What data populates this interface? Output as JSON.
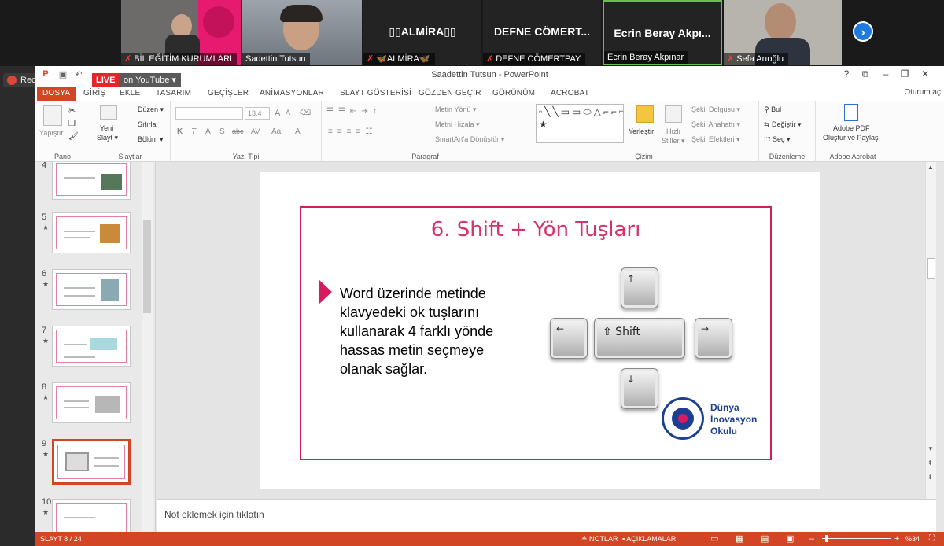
{
  "meeting": {
    "participants": [
      {
        "name": "BİL EĞİTİM KURUMLARI",
        "muted": true,
        "kind": "video"
      },
      {
        "name": "Sadettin Tutsun",
        "muted": false,
        "kind": "video"
      },
      {
        "name": "🦋ALMİRA🦋",
        "display": "▯▯ALMİRA▯▯",
        "muted": true,
        "kind": "name"
      },
      {
        "name": "DEFNE CÖMERTPAY",
        "display": "DEFNE CÖMERT...",
        "muted": true,
        "kind": "name"
      },
      {
        "name": "Ecrin Beray Akpınar",
        "display": "Ecrin Beray Akpı...",
        "muted": false,
        "kind": "name",
        "active": true
      },
      {
        "name": "Sefa Arıoğlu",
        "muted": true,
        "kind": "video"
      }
    ],
    "recording_label": "Recording...",
    "live_label": "LIVE",
    "youtube_label": "on YouTube ▾"
  },
  "window": {
    "title": "Saadettin Tutsun - PowerPoint",
    "controls": [
      "?",
      "⧉",
      "–",
      "❐",
      "✕"
    ],
    "signin": "Oturum aç"
  },
  "ribbon": {
    "tabs": [
      "DOSYA",
      "GİRİŞ",
      "EKLE",
      "TASARIM",
      "GEÇİŞLER",
      "ANİMASYONLAR",
      "SLAYT GÖSTERİSİ",
      "GÖZDEN GEÇİR",
      "GÖRÜNÜM",
      "ACROBAT"
    ],
    "groups": {
      "pano": {
        "label": "Pano",
        "paste": "Yapıştır"
      },
      "slaytlar": {
        "label": "Slaytlar",
        "new_slide_1": "Yeni",
        "new_slide_2": "Slayt ▾",
        "layout": "Düzen ▾",
        "reset": "Sıfırla",
        "section": "Bölüm ▾"
      },
      "yazi_tipi": {
        "label": "Yazı Tipi",
        "font_size": "13,4",
        "bold": "K",
        "italic": "T",
        "underline": "A",
        "shadow": "S",
        "strike": "abc",
        "spacing": "AV",
        "case": "Aa",
        "color": "A"
      },
      "paragraf": {
        "label": "Paragraf",
        "text_dir": "Metin Yönü ▾",
        "align_text": "Metni Hizala ▾",
        "smartart": "SmartArt'a Dönüştür ▾"
      },
      "cizim": {
        "label": "Çizim",
        "arrange": "Yerleştir",
        "quick_styles_1": "Hızlı",
        "quick_styles_2": "Stiller ▾",
        "fill": "Şekil Dolgusu ▾",
        "outline": "Şekil Anahattı ▾",
        "effects": "Şekil Efektleri ▾"
      },
      "duzenleme": {
        "label": "Düzenleme",
        "find": "Bul",
        "replace": "Değiştir ▾",
        "select": "Seç ▾"
      },
      "acrobat": {
        "label": "Adobe Acrobat",
        "pdf_1": "Adobe PDF",
        "pdf_2": "Oluştur ve Paylaş"
      }
    }
  },
  "thumbnails": [
    {
      "num": "4"
    },
    {
      "num": "5"
    },
    {
      "num": "6"
    },
    {
      "num": "7"
    },
    {
      "num": "8"
    },
    {
      "num": "9",
      "selected": true
    },
    {
      "num": "10"
    }
  ],
  "slide": {
    "title": "6. Shift + Yön Tuşları",
    "body": "Word üzerinde metinde klavyedeki ok tuşlarını kullanarak 4 farklı yönde hassas metin seçmeye olanak sağlar.",
    "keys": {
      "up": "↑",
      "down": "↓",
      "left": "←",
      "right": "→",
      "shift": "⇧ Shift"
    },
    "logo_lines": [
      "Dünya",
      "İnovasyon",
      "Okulu"
    ]
  },
  "notes_placeholder": "Not eklemek için tıklatın",
  "status": {
    "slide_indicator": "SLAYT 8 / 24",
    "notes": "≙ NOTLAR",
    "comments": "▪ AÇIKLAMALAR",
    "zoom": "%34"
  },
  "colors": {
    "accent": "#d24625",
    "slide_pink": "#d81b60",
    "logo_blue": "#1c3f94"
  }
}
